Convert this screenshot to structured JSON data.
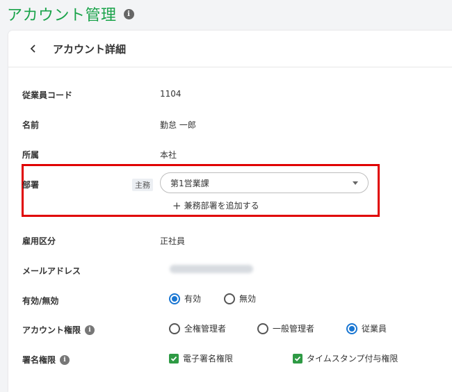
{
  "page": {
    "title": "アカウント管理"
  },
  "card": {
    "title": "アカウント詳細"
  },
  "fields": {
    "employee_code": {
      "label": "従業員コード",
      "value": "1104"
    },
    "name": {
      "label": "名前",
      "value": "勤怠 一郎"
    },
    "affiliation": {
      "label": "所属",
      "value": "本社"
    },
    "department": {
      "label": "部署",
      "badge": "主務",
      "selected": "第1営業課",
      "add_label": "兼務部署を追加する"
    },
    "employment_type": {
      "label": "雇用区分",
      "value": "正社員"
    },
    "email": {
      "label": "メールアドレス"
    },
    "status": {
      "label": "有効/無効",
      "options": [
        "有効",
        "無効"
      ],
      "selected": "有効"
    },
    "account_role": {
      "label": "アカウント権限",
      "options": [
        "全権管理者",
        "一般管理者",
        "従業員"
      ],
      "selected": "従業員"
    },
    "signature_role": {
      "label": "署名権限",
      "options": [
        "電子署名権限",
        "タイムスタンプ付与権限"
      ],
      "checked": [
        true,
        true
      ]
    }
  },
  "colors": {
    "title_green": "#1aa34a",
    "radio_blue": "#1976d2",
    "checkbox_green": "#2e9a44",
    "highlight_red": "#e00000"
  },
  "icons": {
    "info": "info-icon",
    "back": "chevron-left-icon",
    "dropdown": "caret-down-icon",
    "add": "plus-icon",
    "check": "check-icon"
  }
}
